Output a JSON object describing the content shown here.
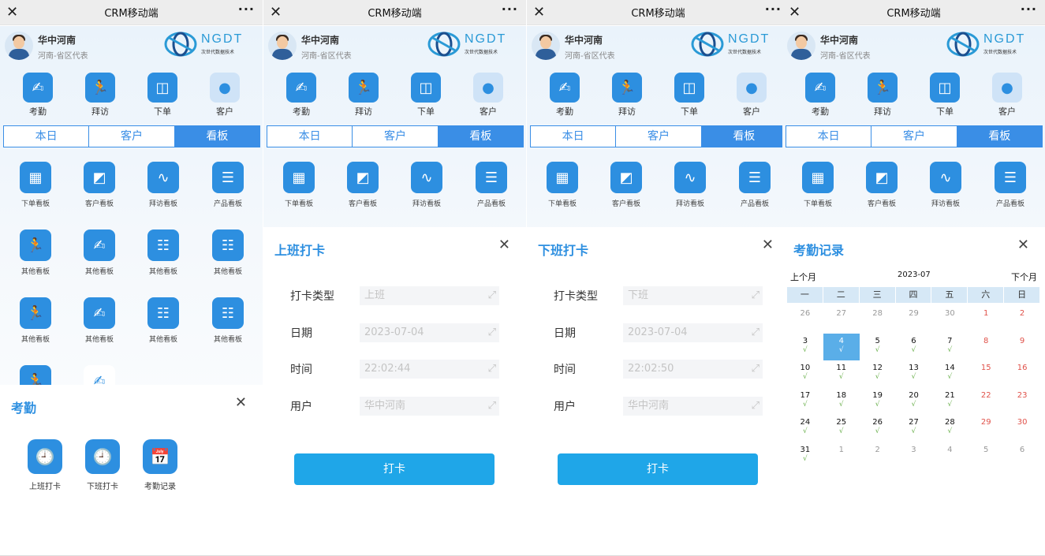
{
  "topbar": {
    "title": "CRM移动端",
    "close_glyph": "✕",
    "more_glyph": "···"
  },
  "header": {
    "name": "华中河南",
    "role": "河南-省区代表",
    "brand": "NGDT",
    "brand_sub": "次世代数据技术"
  },
  "quick_actions": [
    "考勤",
    "拜访",
    "下单",
    "客户"
  ],
  "tabs": [
    "本日",
    "客户",
    "看板"
  ],
  "boards_top": [
    "下单看板",
    "客户看板",
    "拜访看板",
    "产品看板"
  ],
  "boards_more": [
    "其他看板",
    "其他看板",
    "其他看板",
    "其他看板",
    "其他看板",
    "其他看板",
    "其他看板",
    "其他看板"
  ],
  "attendance": {
    "title": "考勤",
    "close_glyph": "✕",
    "items": [
      "上班打卡",
      "下班打卡",
      "考勤记录"
    ]
  },
  "checkin": {
    "title": "上班打卡",
    "close_glyph": "✕",
    "labels": [
      "打卡类型",
      "日期",
      "时间",
      "用户"
    ],
    "values": [
      "上班",
      "2023-07-04",
      "22:02:44",
      "华中河南"
    ],
    "button": "打卡"
  },
  "checkout": {
    "title": "下班打卡",
    "close_glyph": "✕",
    "labels": [
      "打卡类型",
      "日期",
      "时间",
      "用户"
    ],
    "values": [
      "下班",
      "2023-07-04",
      "22:02:50",
      "华中河南"
    ],
    "button": "打卡"
  },
  "records": {
    "title": "考勤记录",
    "close_glyph": "✕",
    "prev": "上个月",
    "month": "2023-07",
    "next": "下个月",
    "weekdays": [
      "一",
      "二",
      "三",
      "四",
      "五",
      "六",
      "日"
    ],
    "check_glyph": "√",
    "days": [
      {
        "d": "26",
        "s": "dim"
      },
      {
        "d": "27",
        "s": "dim"
      },
      {
        "d": "28",
        "s": "dim"
      },
      {
        "d": "29",
        "s": "dim"
      },
      {
        "d": "30",
        "s": "dim"
      },
      {
        "d": "1",
        "s": "red"
      },
      {
        "d": "2",
        "s": "red"
      },
      {
        "d": "3",
        "c": true
      },
      {
        "d": "4",
        "s": "sel",
        "c": true
      },
      {
        "d": "5",
        "c": true
      },
      {
        "d": "6",
        "c": true
      },
      {
        "d": "7",
        "c": true
      },
      {
        "d": "8",
        "s": "red"
      },
      {
        "d": "9",
        "s": "red"
      },
      {
        "d": "10",
        "c": true
      },
      {
        "d": "11",
        "c": true
      },
      {
        "d": "12",
        "c": true
      },
      {
        "d": "13",
        "c": true
      },
      {
        "d": "14",
        "c": true
      },
      {
        "d": "15",
        "s": "red"
      },
      {
        "d": "16",
        "s": "red"
      },
      {
        "d": "17",
        "c": true
      },
      {
        "d": "18",
        "c": true
      },
      {
        "d": "19",
        "c": true
      },
      {
        "d": "20",
        "c": true
      },
      {
        "d": "21",
        "c": true
      },
      {
        "d": "22",
        "s": "red"
      },
      {
        "d": "23",
        "s": "red"
      },
      {
        "d": "24",
        "c": true
      },
      {
        "d": "25",
        "c": true
      },
      {
        "d": "26",
        "c": true
      },
      {
        "d": "27",
        "c": true
      },
      {
        "d": "28",
        "c": true
      },
      {
        "d": "29",
        "s": "red"
      },
      {
        "d": "30",
        "s": "red"
      },
      {
        "d": "31",
        "c": true
      },
      {
        "d": "1",
        "s": "dim"
      },
      {
        "d": "2",
        "s": "dim"
      },
      {
        "d": "3",
        "s": "dim"
      },
      {
        "d": "4",
        "s": "dim"
      },
      {
        "d": "5",
        "s": "dim"
      },
      {
        "d": "6",
        "s": "dim"
      }
    ]
  },
  "colors": {
    "primary": "#2d8fe0",
    "tab_blue": "#3a8ee6",
    "button": "#1fa6e8",
    "weekend": "#e0524a",
    "check": "#6ab04c"
  }
}
